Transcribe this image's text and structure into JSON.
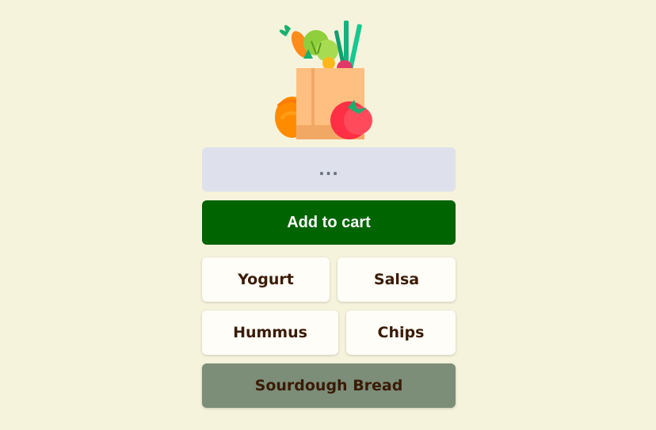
{
  "search": {
    "value": "..."
  },
  "actions": {
    "add_to_cart_label": "Add to cart"
  },
  "items": [
    {
      "label": "Yogurt"
    },
    {
      "label": "Salsa"
    },
    {
      "label": "Hummus"
    },
    {
      "label": "Chips"
    },
    {
      "label": "Sourdough Bread",
      "selected": true
    }
  ],
  "colors": {
    "background": "#f5f3dc",
    "primary": "#006400",
    "input_bg": "#dee1ec",
    "chip_bg": "#fffdf7",
    "selected_bg": "#7c8d78",
    "text_dark": "#3a1b05"
  }
}
